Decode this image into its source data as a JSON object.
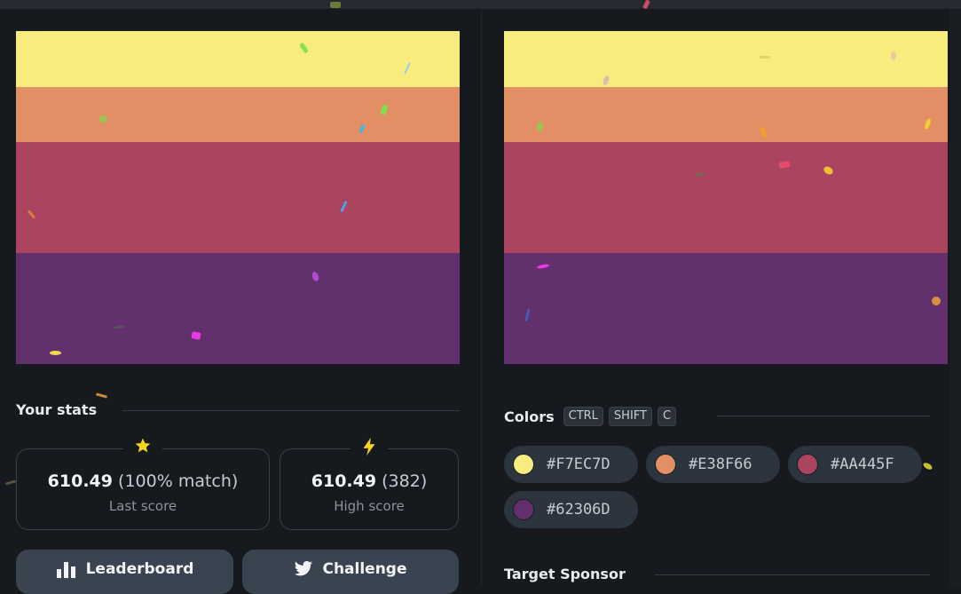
{
  "palette": {
    "colors": [
      "#F7EC7D",
      "#E38F66",
      "#AA445F",
      "#62306D"
    ]
  },
  "stats": {
    "heading": "Your stats",
    "last": {
      "value": "610.49",
      "detail": "(100% match)",
      "label": "Last score",
      "icon": "star-icon"
    },
    "high": {
      "value": "610.49",
      "detail": "(382)",
      "label": "High score",
      "icon": "lightning-icon"
    }
  },
  "buttons": {
    "leaderboard": "Leaderboard",
    "challenge": "Challenge"
  },
  "colors_section": {
    "heading": "Colors",
    "shortcut": [
      "CTRL",
      "SHIFT",
      "C"
    ],
    "chips": [
      {
        "hex": "#F7EC7D",
        "label": "#F7EC7D"
      },
      {
        "hex": "#E38F66",
        "label": "#E38F66"
      },
      {
        "hex": "#AA445F",
        "label": "#AA445F"
      },
      {
        "hex": "#62306D",
        "label": "#62306D"
      }
    ]
  },
  "sponsor": {
    "heading": "Target Sponsor"
  }
}
